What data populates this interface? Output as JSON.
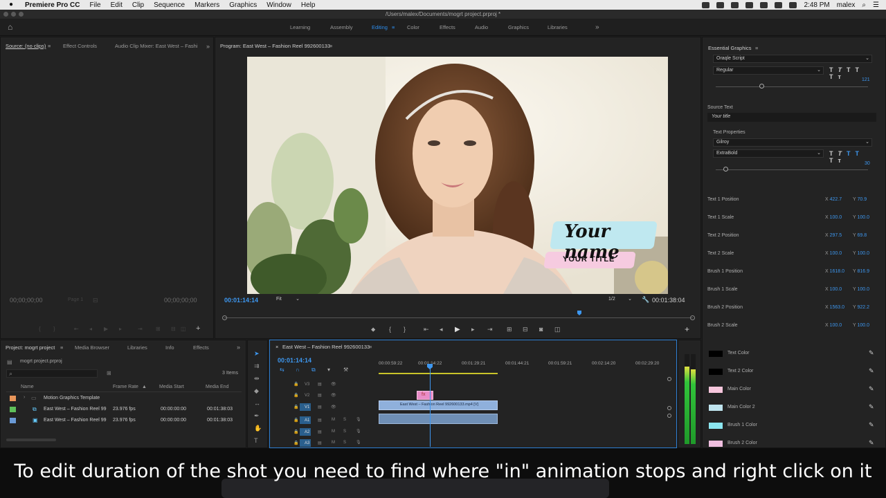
{
  "menubar": {
    "app": "Premiere Pro CC",
    "items": [
      "File",
      "Edit",
      "Clip",
      "Sequence",
      "Markers",
      "Graphics",
      "Window",
      "Help"
    ],
    "clock": "2:48 PM",
    "user": "malex"
  },
  "titlebar": {
    "path": "/Users/malex/Documents/mogrt project.prproj *"
  },
  "workspaces": [
    "Learning",
    "Assembly",
    "Editing",
    "Color",
    "Effects",
    "Audio",
    "Graphics",
    "Libraries"
  ],
  "workspace_active": "Editing",
  "source": {
    "tabs": [
      "Source: (no clips)",
      "Effect Controls",
      "Audio Clip Mixer: East West – Fashi"
    ],
    "tc_left": "00;00;00;00",
    "tc_right": "00;00;00;00",
    "page": "Page 1"
  },
  "program": {
    "title": "Program: East West – Fashion Reel 992600133",
    "tc_current": "00:01:14:14",
    "fit": "Fit",
    "res": "1/2",
    "tc_duration": "00:01:38:04",
    "overlay_name": "Your name",
    "overlay_title": "YOUR TITLE"
  },
  "eg": {
    "title": "Essential Graphics",
    "font1": "Oraqle Script",
    "style1": "Regular",
    "size1": "121",
    "source_text_label": "Source Text",
    "source_text_value": "Your title",
    "text_props_label": "Text Properties",
    "font2": "Gilroy",
    "style2": "ExtraBold",
    "size2": "30",
    "props": [
      {
        "label": "Text 1 Position",
        "x": "422.7",
        "y": "70.9"
      },
      {
        "label": "Text 1 Scale",
        "x": "100.0",
        "y": "100.0"
      },
      {
        "label": "Text 2 Position",
        "x": "297.5",
        "y": "69.8"
      },
      {
        "label": "Text 2 Scale",
        "x": "100.0",
        "y": "100.0"
      },
      {
        "label": "Brush 1 Position",
        "x": "1618.0",
        "y": "816.9"
      },
      {
        "label": "Brush 1 Scale",
        "x": "100.0",
        "y": "100.0"
      },
      {
        "label": "Brush 2 Position",
        "x": "1563.0",
        "y": "922.2"
      },
      {
        "label": "Brush 2 Scale",
        "x": "100.0",
        "y": "100.0"
      }
    ],
    "colors": [
      {
        "label": "Text Color",
        "hex": "#000000"
      },
      {
        "label": "Text 2 Color",
        "hex": "#000000"
      },
      {
        "label": "Main Color",
        "hex": "#f6c6dc"
      },
      {
        "label": "Main Color 2",
        "hex": "#bfe4ee"
      },
      {
        "label": "Brush 1 Color",
        "hex": "#8be6f0"
      },
      {
        "label": "Brush 2 Color",
        "hex": "#f0bfe0"
      }
    ]
  },
  "project": {
    "tabs": [
      "Project: mogrt project",
      "Media Browser",
      "Libraries",
      "Info",
      "Effects"
    ],
    "file": "mogrt project.prproj",
    "items_count": "3 Items",
    "columns": [
      "Name",
      "Frame Rate",
      "Media Start",
      "Media End"
    ],
    "rows": [
      {
        "name": "Motion Graphics Template",
        "rate": "",
        "start": "",
        "end": "",
        "color": "#e8955a"
      },
      {
        "name": "East West – Fashion Reel 99",
        "rate": "23.976 fps",
        "start": "00:00:00:00",
        "end": "00:01:38:03",
        "color": "#5fbf5a"
      },
      {
        "name": "East West – Fashion Reel 99",
        "rate": "23.976 fps",
        "start": "00:00:00:00",
        "end": "00:01:38:03",
        "color": "#6a9ad6"
      }
    ]
  },
  "timeline": {
    "title": "East West – Fashion Reel 992600133",
    "tc": "00:01:14:14",
    "ruler": [
      "00:00:59:22",
      "00:01:14:22",
      "00:01:29:21",
      "00:01:44:21",
      "00:01:59:21",
      "00:02:14:20",
      "00:02:29:20"
    ],
    "tracks": [
      "V3",
      "V2",
      "V1",
      "A1",
      "A2",
      "A3"
    ],
    "clip_label": "East West – Fashion Reel 992600133.mp4 [V]"
  },
  "caption": "To edit duration of the shot you need to find where \"in\" animation stops and right click on it"
}
